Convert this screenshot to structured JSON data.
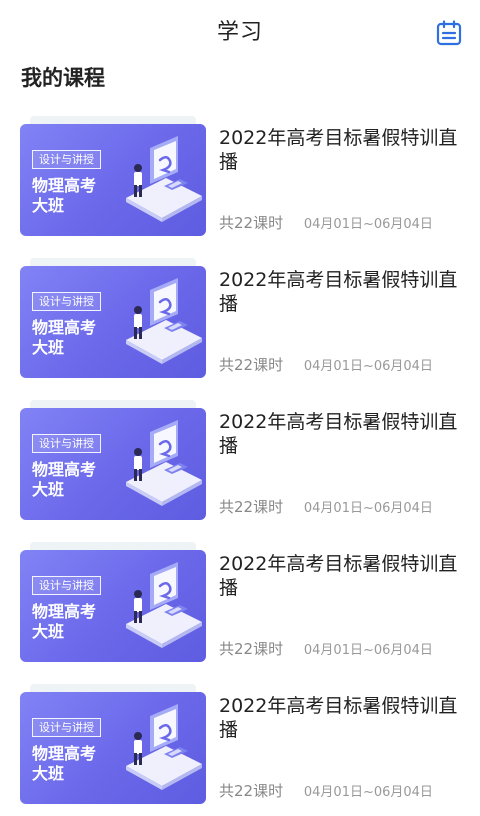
{
  "header": {
    "title": "学习",
    "calendar_icon": "calendar-icon"
  },
  "section": {
    "title": "我的课程"
  },
  "accent_color": "#2f6fe0",
  "thumbnail": {
    "tag": "设计与讲授",
    "line1": "物理高考",
    "line2": "大班",
    "colors": [
      "#8183f5",
      "#5e5ce0"
    ]
  },
  "courses": [
    {
      "title": "2022年高考目标暑假特训直播",
      "lessons": "共22课时",
      "dates": "04月01日~06月04日"
    },
    {
      "title": "2022年高考目标暑假特训直播",
      "lessons": "共22课时",
      "dates": "04月01日~06月04日"
    },
    {
      "title": "2022年高考目标暑假特训直播",
      "lessons": "共22课时",
      "dates": "04月01日~06月04日"
    },
    {
      "title": "2022年高考目标暑假特训直播",
      "lessons": "共22课时",
      "dates": "04月01日~06月04日"
    },
    {
      "title": "2022年高考目标暑假特训直播",
      "lessons": "共22课时",
      "dates": "04月01日~06月04日"
    }
  ]
}
